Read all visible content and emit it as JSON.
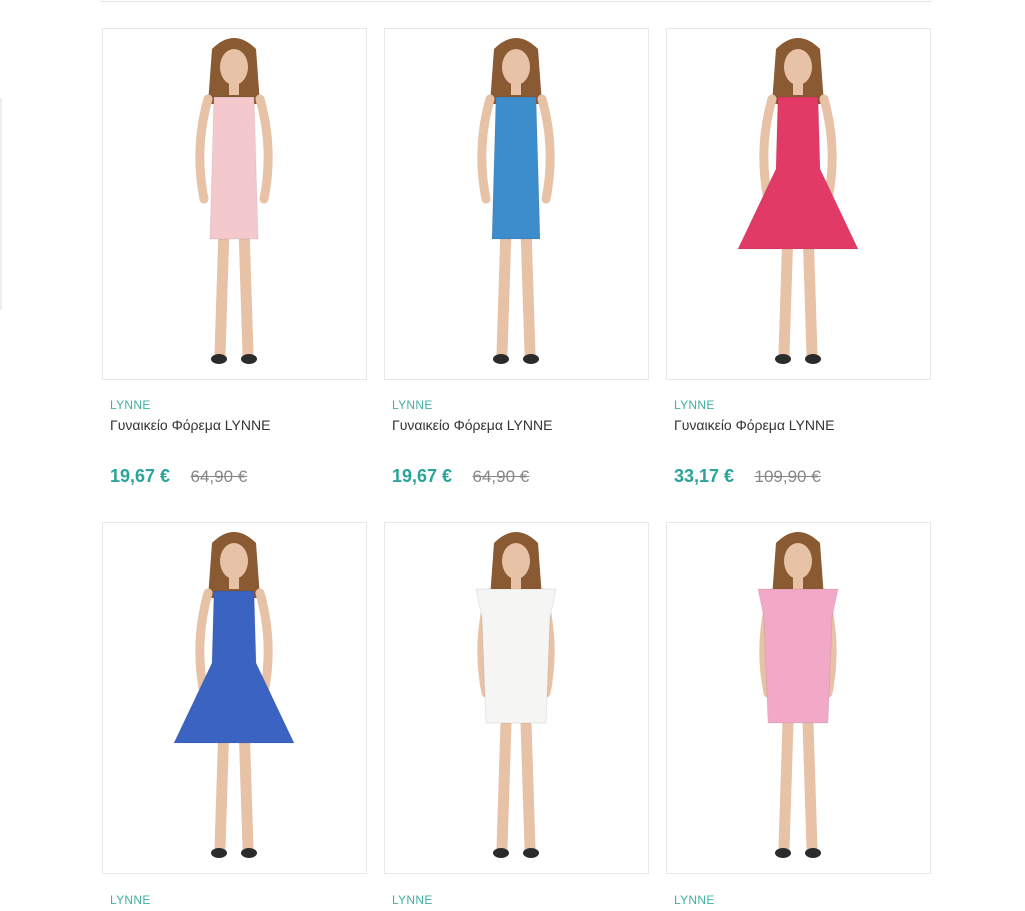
{
  "products": [
    {
      "brand": "LYNNE",
      "name": "Γυναικείο Φόρεμα LYNNE",
      "price": "19,67 €",
      "old_price": "64,90 €",
      "image_alt": "pink slip dress",
      "dress_color": "#f4c9cd",
      "style": "slip"
    },
    {
      "brand": "LYNNE",
      "name": "Γυναικείο Φόρεμα LYNNE",
      "price": "19,67 €",
      "old_price": "64,90 €",
      "image_alt": "blue slip dress",
      "dress_color": "#3d8ccc",
      "style": "slip"
    },
    {
      "brand": "LYNNE",
      "name": "Γυναικείο Φόρεμα LYNNE",
      "price": "33,17 €",
      "old_price": "109,90 €",
      "image_alt": "red lace skater dress",
      "dress_color": "#e23a66",
      "style": "skater"
    },
    {
      "brand": "LYNNE",
      "name": "",
      "price": "",
      "old_price": "",
      "image_alt": "blue lace skater dress",
      "dress_color": "#3a63c2",
      "style": "skater"
    },
    {
      "brand": "LYNNE",
      "name": "",
      "price": "",
      "old_price": "",
      "image_alt": "white shift dress with ruffle sleeves",
      "dress_color": "#f5f5f3",
      "style": "shift"
    },
    {
      "brand": "LYNNE",
      "name": "",
      "price": "",
      "old_price": "",
      "image_alt": "pink shift dress with ruffle sleeves",
      "dress_color": "#f2a9c7",
      "style": "shift"
    }
  ],
  "colors": {
    "brand": "#3fb0a2",
    "price": "#2aa39a",
    "old_price": "#888888",
    "skin": "#e8c2a7",
    "hair": "#8a5a33"
  }
}
